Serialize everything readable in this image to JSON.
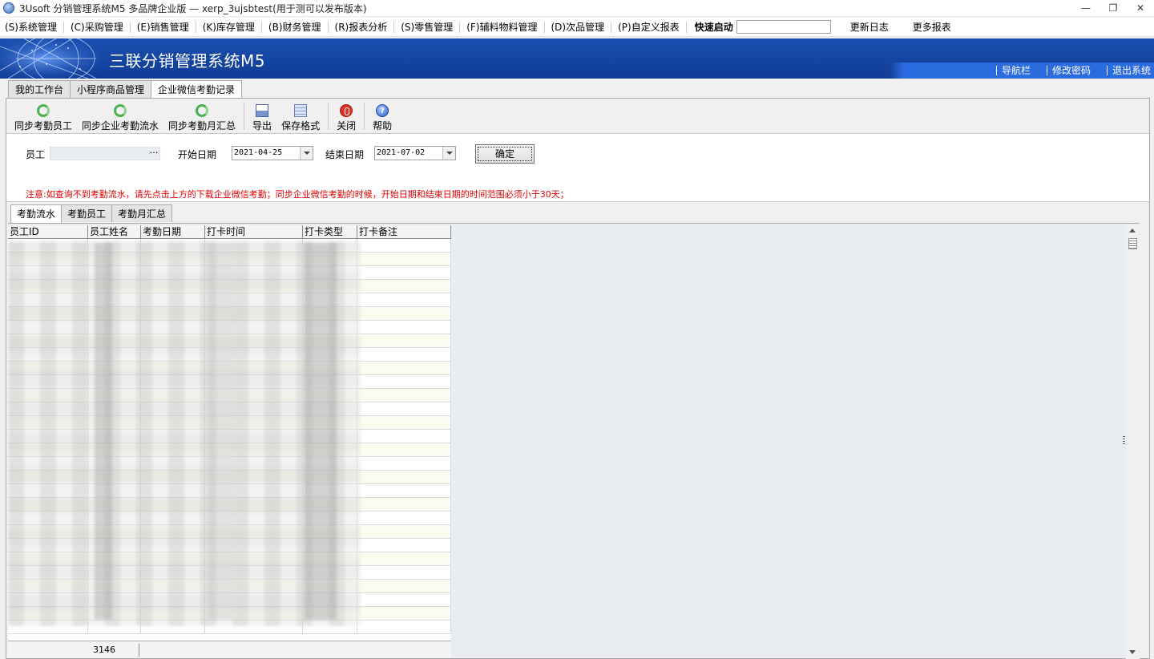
{
  "window": {
    "title": "3Usoft 分销管理系统M5 多品牌企业版 — xerp_3ujsbtest(用于测可以发布版本)",
    "controls": [
      "—",
      "❐",
      "✕"
    ]
  },
  "menubar": {
    "items": [
      {
        "label": "(S)系统管理"
      },
      {
        "label": "(C)采购管理"
      },
      {
        "label": "(E)销售管理"
      },
      {
        "label": "(K)库存管理"
      },
      {
        "label": "(B)财务管理"
      },
      {
        "label": "(R)报表分析"
      },
      {
        "label": "(S)零售管理"
      },
      {
        "label": "(F)辅料物料管理"
      },
      {
        "label": "(D)次品管理"
      },
      {
        "label": "(P)自定义报表"
      }
    ],
    "quick_start_label": "快速启动",
    "quick_start_value": "",
    "changelog": "更新日志",
    "more_reports": "更多报表"
  },
  "banner": {
    "app_name": "三联分销管理系统M5",
    "nav": "导航栏",
    "change_password": "修改密码",
    "logout": "退出系统"
  },
  "main_tabs": [
    {
      "label": "我的工作台",
      "active": false
    },
    {
      "label": "小程序商品管理",
      "active": false
    },
    {
      "label": "企业微信考勤记录",
      "active": true
    }
  ],
  "toolbar": {
    "sync_employees": "同步考勤员工",
    "sync_flow": "同步企业考勤流水",
    "sync_monthly": "同步考勤月汇总",
    "export": "导出",
    "save_format": "保存格式",
    "close": "关闭",
    "help": "帮助",
    "help_glyph": "?"
  },
  "filter": {
    "employee_label": "员工",
    "employee_value": "",
    "employee_btn": "···",
    "start_label": "开始日期",
    "start_value": "2021-04-25",
    "end_label": "结束日期",
    "end_value": "2021-07-02",
    "confirm": "确定",
    "note": "注意:如查询不到考勤流水，请先点击上方的下载企业微信考勤；同步企业微信考勤的时候，开始日期和结束日期的时间范围必须小于30天；"
  },
  "sub_tabs": [
    {
      "label": "考勤流水",
      "active": true
    },
    {
      "label": "考勤员工",
      "active": false
    },
    {
      "label": "考勤月汇总",
      "active": false
    }
  ],
  "grid": {
    "columns": [
      "员工ID",
      "员工姓名",
      "考勤日期",
      "打卡时间",
      "打卡类型",
      "打卡备注"
    ],
    "row_count": "3146"
  },
  "colors": {
    "banner": "#1b4fb0",
    "note_red": "#e00000"
  }
}
